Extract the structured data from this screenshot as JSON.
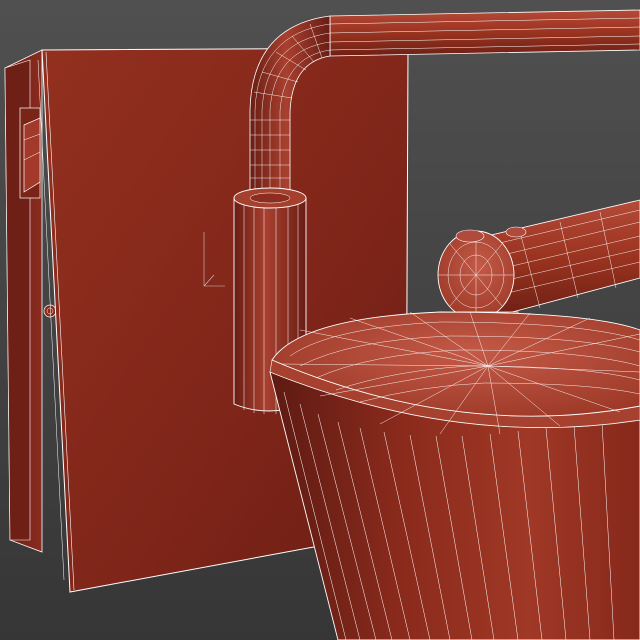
{
  "viewport": {
    "background_top": "#4f4f4f",
    "background_bottom": "#363636"
  },
  "model": {
    "subject": "wall-sconce-lamp-wireframe",
    "surface_color": "#8f2d22",
    "surface_shadow": "#5e1a14",
    "surface_highlight": "#b04a3c",
    "wire_color": "#ffffff"
  }
}
